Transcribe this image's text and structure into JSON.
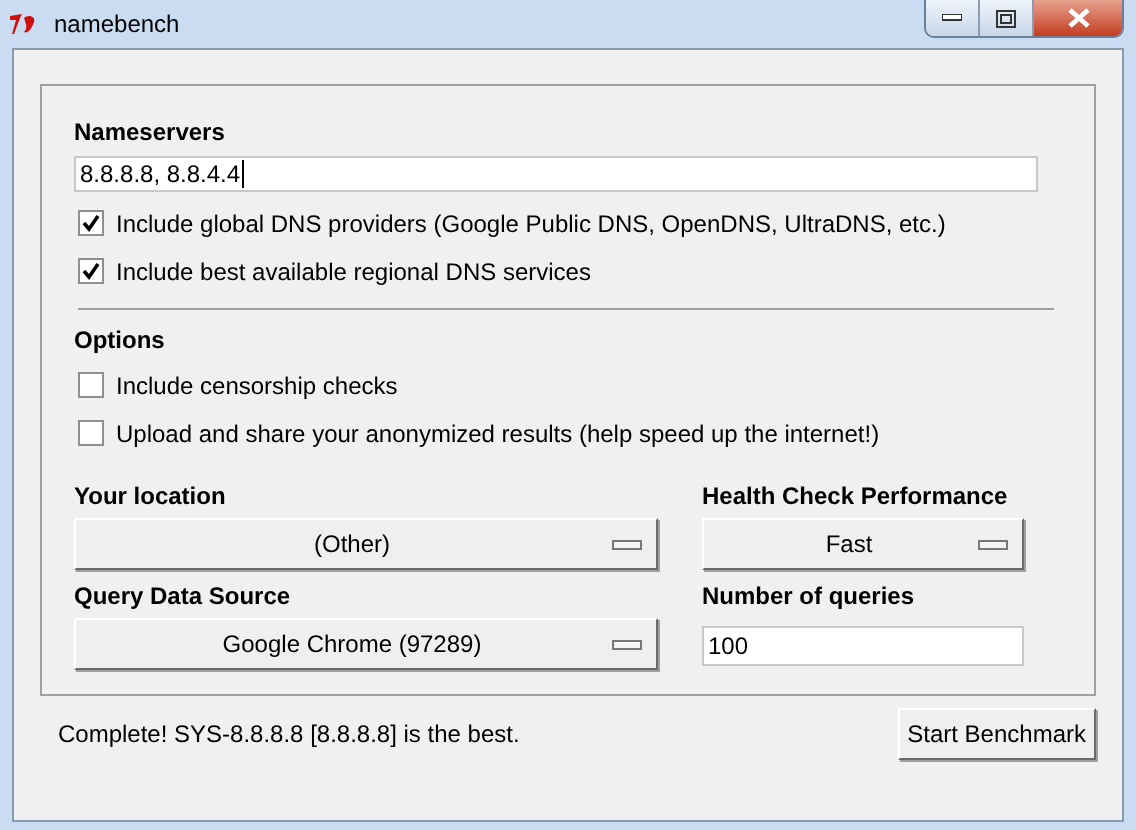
{
  "window": {
    "title": "namebench"
  },
  "nameservers": {
    "label": "Nameservers",
    "value": "8.8.8.8, 8.8.4.4"
  },
  "nameserver_options": [
    {
      "label": "Include global DNS providers (Google Public DNS, OpenDNS, UltraDNS, etc.)",
      "checked": true
    },
    {
      "label": "Include best available regional DNS services",
      "checked": true
    }
  ],
  "options": {
    "title": "Options",
    "items": [
      {
        "label": "Include censorship checks",
        "checked": false
      },
      {
        "label": "Upload and share your anonymized results (help speed up the internet!)",
        "checked": false
      }
    ]
  },
  "fields": [
    {
      "kind": "dropdown",
      "label": "Your location",
      "value": "(Other)"
    },
    {
      "kind": "dropdown",
      "label": "Health Check Performance",
      "value": "Fast"
    },
    {
      "kind": "dropdown",
      "label": "Query Data Source",
      "value": "Google Chrome (97289)"
    },
    {
      "kind": "input",
      "label": "Number of queries",
      "value": "100"
    }
  ],
  "status": "Complete! SYS-8.8.8.8 [8.8.8.8] is the best.",
  "button": "Start Benchmark"
}
